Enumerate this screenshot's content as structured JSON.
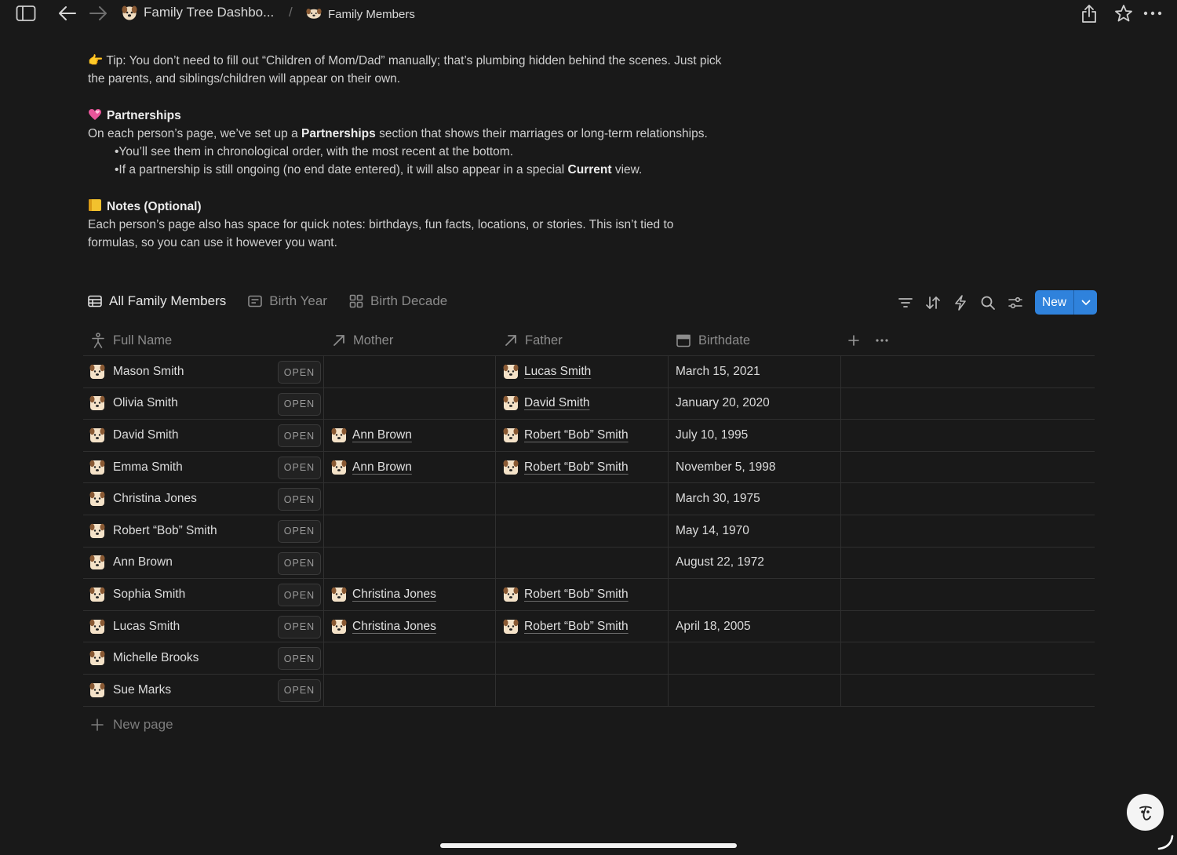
{
  "topbar": {
    "breadcrumb_parent": "Family Tree Dashbo...",
    "breadcrumb_separator": "/",
    "breadcrumb_current": "Family Members"
  },
  "doc": {
    "tip_line1": "👉 Tip: You don’t need to fill out “Children of Mom/Dad” manually; that’s plumbing hidden behind the scenes. Just pick",
    "tip_line2": "the parents, and siblings/children will appear on their own.",
    "partnerships_heading": "Partnerships",
    "partnerships_pre": "On each person’s page, we’ve set up a ",
    "partnerships_bold": "Partnerships",
    "partnerships_post": " section that shows their marriages or long-term relationships.",
    "bullet1": "•You’ll see them in chronological order, with the most recent at the bottom.",
    "bullet2_pre": "•If a partnership is still ongoing (no end date entered), it will also appear in a special ",
    "bullet2_bold": "Current",
    "bullet2_post": " view.",
    "notes_heading": "Notes (Optional)",
    "notes_line1": "Each person’s page also has space for quick notes:  birthdays, fun facts, locations, or stories. This isn’t tied to",
    "notes_line2": "formulas, so you can use it however you want."
  },
  "views": {
    "tabs": [
      {
        "label": "All Family Members"
      },
      {
        "label": "Birth Year"
      },
      {
        "label": "Birth Decade"
      }
    ],
    "new_label": "New"
  },
  "table": {
    "columns": [
      "Full Name",
      "Mother",
      "Father",
      "Birthdate"
    ],
    "open_label": "OPEN",
    "rows": [
      {
        "name": "Mason Smith",
        "mother": "",
        "father": "Lucas Smith",
        "birthdate": "March 15, 2021"
      },
      {
        "name": "Olivia Smith",
        "mother": "",
        "father": "David Smith",
        "birthdate": "January 20, 2020"
      },
      {
        "name": "David Smith",
        "mother": "Ann Brown",
        "father": "Robert “Bob” Smith",
        "birthdate": "July 10, 1995"
      },
      {
        "name": "Emma Smith",
        "mother": "Ann Brown",
        "father": "Robert “Bob” Smith",
        "birthdate": "November 5, 1998"
      },
      {
        "name": "Christina Jones",
        "mother": "",
        "father": "",
        "birthdate": "March 30, 1975"
      },
      {
        "name": "Robert “Bob” Smith",
        "mother": "",
        "father": "",
        "birthdate": "May 14, 1970"
      },
      {
        "name": "Ann Brown",
        "mother": "",
        "father": "",
        "birthdate": "August 22, 1972"
      },
      {
        "name": "Sophia Smith",
        "mother": "Christina Jones",
        "father": "Robert “Bob” Smith",
        "birthdate": ""
      },
      {
        "name": "Lucas Smith",
        "mother": "Christina Jones",
        "father": "Robert “Bob” Smith",
        "birthdate": "April 18, 2005"
      },
      {
        "name": "Michelle Brooks",
        "mother": "",
        "father": "",
        "birthdate": ""
      },
      {
        "name": "Sue Marks",
        "mother": "",
        "father": "",
        "birthdate": ""
      }
    ],
    "new_page_label": "New page"
  },
  "colors": {
    "background": "#191919",
    "accent": "#2f82dc",
    "text": "#d4d4d4"
  }
}
